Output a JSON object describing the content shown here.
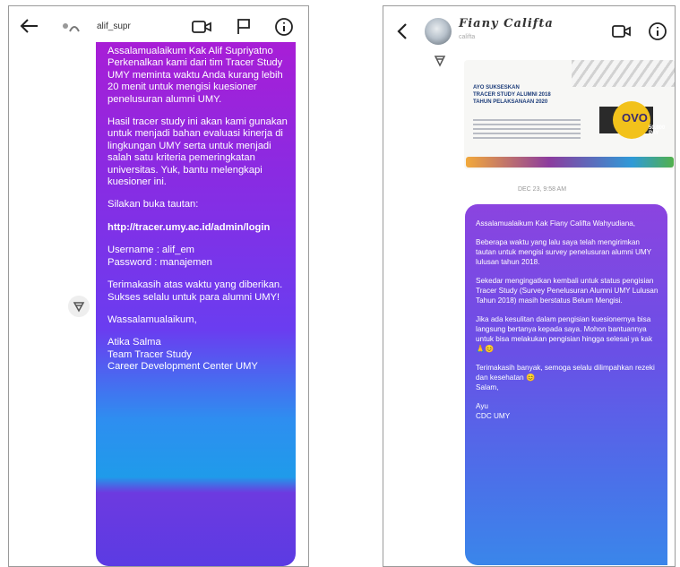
{
  "left": {
    "header": {
      "username": "alif_supr",
      "icons": [
        "back-arrow-icon",
        "video-call-icon",
        "flag-icon",
        "info-icon"
      ]
    },
    "message": {
      "paragraph_1": "Assalamualaikum Kak Alif Supriyatno\nPerkenalkan kami dari tim Tracer Study UMY meminta waktu Anda kurang lebih 20 menit untuk mengisi kuesioner penelusuran alumni UMY.",
      "paragraph_2": "Hasil tracer study ini akan kami gunakan untuk menjadi bahan evaluasi kinerja di lingkungan UMY serta untuk menjadi salah satu kriteria pemeringkatan universitas. Yuk, bantu melengkapi kuesioner ini.",
      "paragraph_3": "Silakan buka tautan:",
      "link": "http://tracer.umy.ac.id/admin/login",
      "paragraph_4": "Username : alif_em\nPassword : manajemen",
      "paragraph_5": "Terimakasih atas waktu yang diberikan.\nSukses selalu untuk para alumni UMY!",
      "paragraph_6": "Wassalamualaikum,",
      "paragraph_7": "Atika Salma\nTeam Tracer Study\nCareer Development Center UMY"
    }
  },
  "right": {
    "header": {
      "name": "Fiany Califta",
      "subtitle": "califta",
      "icons": [
        "back-chevron-icon",
        "video-call-icon",
        "info-icon"
      ]
    },
    "post_card": {
      "title": "AYO SUKSESKAN\nTRACER STUDY ALUMNI 2018\nTAHUN PELAKSANAAN 2020",
      "brand": "OVO",
      "brand_sub": "50.000 PAY"
    },
    "timestamp": "DEC 23, 9:58 AM",
    "message": {
      "paragraph_1": "Assalamualaikum Kak Fiany Califta Wahyudiana,",
      "paragraph_2": "Beberapa waktu yang lalu saya telah mengirimkan tautan untuk mengisi survey penelusuran alumni UMY lulusan tahun 2018.",
      "paragraph_3": "Sekedar mengingatkan kembali untuk status pengisian Tracer Study (Survey Penelusuran Alumni UMY Lulusan Tahun 2018) masih berstatus Belum Mengisi.",
      "paragraph_4": "Jika ada kesulitan dalam pengisian kuesionernya bisa langsung bertanya kepada saya. Mohon bantuannya untuk bisa melakukan pengisian hingga selesai ya kak 🙏😊",
      "paragraph_5": "Terimakasih banyak, semoga selalu dilimpahkan rezeki dan kesehatan 😊\nSalam,",
      "paragraph_6": "Ayu\nCDC UMY"
    }
  }
}
